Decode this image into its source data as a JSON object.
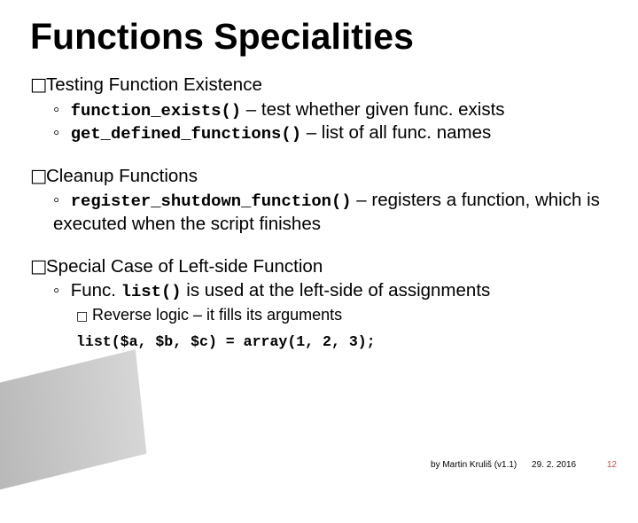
{
  "title": "Functions Specialities",
  "sections": [
    {
      "heading_pre": "Testing",
      "heading_post": " Function Existence",
      "items": [
        {
          "code": "function_exists()",
          "desc": " – test whether given func. exists"
        },
        {
          "code": "get_defined_functions()",
          "desc": " – list of all func. names"
        }
      ]
    },
    {
      "heading_pre": "Cleanup",
      "heading_post": " Functions",
      "items": [
        {
          "code": "register_shutdown_function()",
          "desc": " – registers a function, which is executed when the script finishes"
        }
      ]
    },
    {
      "heading_pre": "Special",
      "heading_post": " Case of Left-side Function",
      "items": [
        {
          "pre": "Func. ",
          "code": "list()",
          "desc": " is used at the left-side of assignments"
        }
      ],
      "sub3": "Reverse logic – it fills its arguments",
      "codeline": "list($a, $b, $c) = array(1, 2, 3);"
    }
  ],
  "footer": {
    "by": "by Martin Kruliš (v1.1)",
    "date": "29. 2. 2016",
    "page": "12"
  }
}
